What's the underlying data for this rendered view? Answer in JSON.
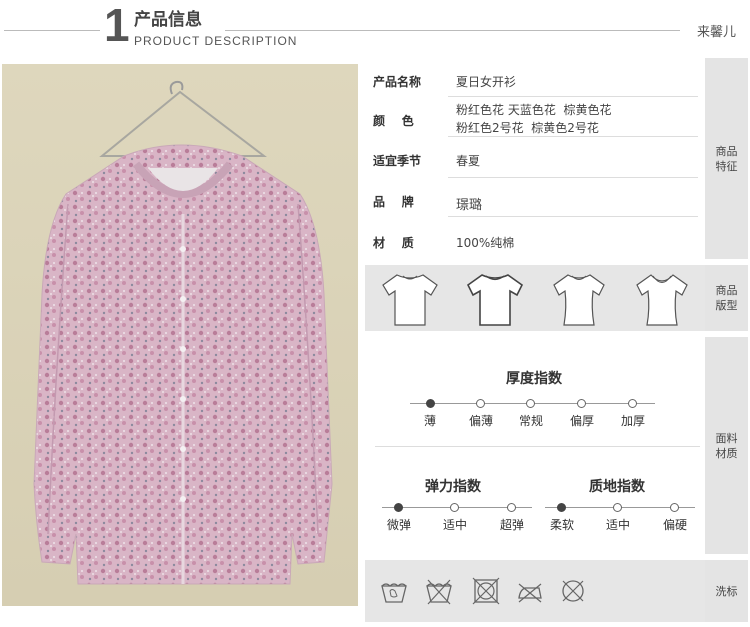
{
  "header": {
    "number": "1",
    "title_cn": "产品信息",
    "title_en": "PRODUCT DESCRIPTION",
    "brand": "来馨儿"
  },
  "properties": [
    {
      "label": "产品名称",
      "value": "夏日女开衫"
    },
    {
      "label": "颜    色",
      "value": "粉红色花 天蓝色花  棕黄色花",
      "value2": "粉红色2号花  棕黄色2号花"
    },
    {
      "label": "适宜季节",
      "value": "春夏"
    },
    {
      "label": "品    牌",
      "value": "璟璐"
    },
    {
      "label": "材    质",
      "value": "100%纯棉"
    }
  ],
  "side_tabs": {
    "features": [
      "商品",
      "特征"
    ],
    "shape": [
      "商品",
      "版型"
    ],
    "material": [
      "面料",
      "材质"
    ],
    "wash": "洗标"
  },
  "thickness": {
    "title": "厚度指数",
    "options": [
      "薄",
      "偏薄",
      "常规",
      "偏厚",
      "加厚"
    ],
    "selected_index": 0
  },
  "elasticity": {
    "title": "弹力指数",
    "options": [
      "微弹",
      "适中",
      "超弹"
    ],
    "selected_index": 0
  },
  "texture": {
    "title": "质地指数",
    "options": [
      "柔软",
      "适中",
      "偏硬"
    ],
    "selected_index": 0
  },
  "shape_icons": [
    "tshirt-wide-icon",
    "tshirt-boxy-icon",
    "tshirt-fitted-icon",
    "tshirt-scoop-icon"
  ],
  "care_icons": [
    "hand-wash-icon",
    "no-wash-icon",
    "no-tumble-dry-icon",
    "no-iron-icon",
    "no-dry-clean-icon"
  ]
}
